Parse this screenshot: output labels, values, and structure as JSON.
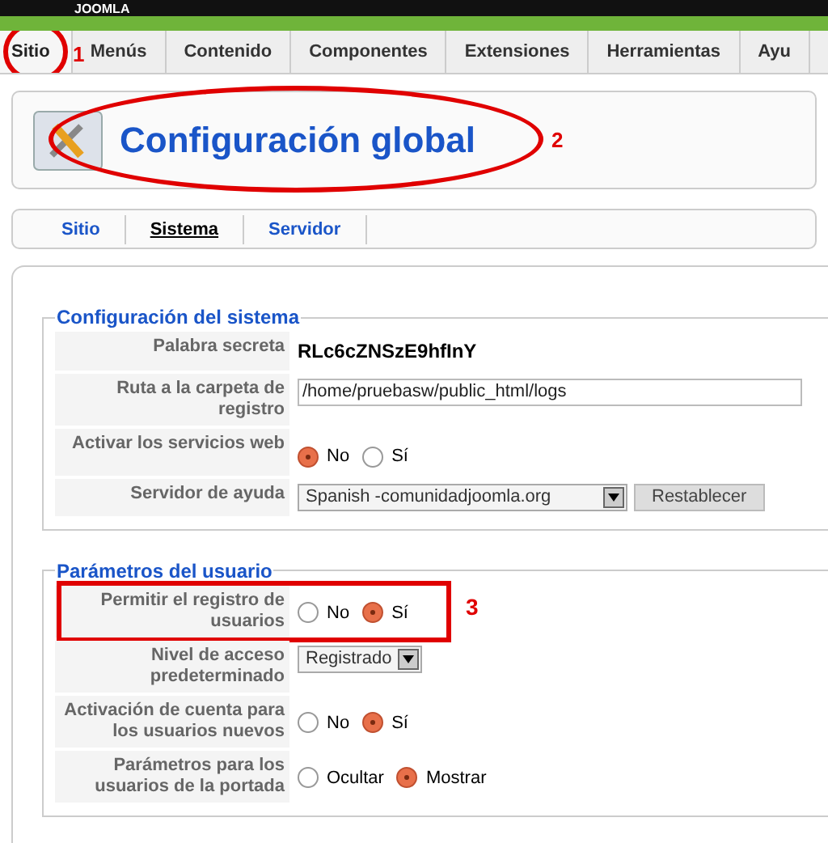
{
  "brand": "JOOMLA",
  "menu": [
    {
      "label": "Sitio",
      "selected": true
    },
    {
      "label": "Menús",
      "selected": false
    },
    {
      "label": "Contenido",
      "selected": false
    },
    {
      "label": "Componentes",
      "selected": false
    },
    {
      "label": "Extensiones",
      "selected": false
    },
    {
      "label": "Herramientas",
      "selected": false
    },
    {
      "label": "Ayu",
      "selected": false
    }
  ],
  "page_title": "Configuración global",
  "subtabs": [
    {
      "label": "Sitio",
      "selected": false
    },
    {
      "label": "Sistema",
      "selected": true
    },
    {
      "label": "Servidor",
      "selected": false
    }
  ],
  "fieldsets": [
    {
      "legend": "Configuración del sistema",
      "rows": [
        {
          "kind": "text",
          "label": "Palabra secreta",
          "value": "RLc6cZNSzE9hfInY"
        },
        {
          "kind": "input",
          "label": "Ruta a la carpeta de registro",
          "value": "/home/pruebasw/public_html/logs"
        },
        {
          "kind": "radio",
          "label": "Activar los servicios web",
          "options": [
            {
              "label": "No",
              "selected": true
            },
            {
              "label": "Sí",
              "selected": false
            }
          ]
        },
        {
          "kind": "select",
          "label": "Servidor de ayuda",
          "value": "Spanish -comunidadjoomla.org",
          "button": "Restablecer"
        }
      ]
    },
    {
      "legend": "Parámetros del usuario",
      "rows": [
        {
          "kind": "radio",
          "label": "Permitir el registro de usuarios",
          "highlighted": true,
          "options": [
            {
              "label": "No",
              "selected": false
            },
            {
              "label": "Sí",
              "selected": true
            }
          ]
        },
        {
          "kind": "select",
          "label": "Nivel de acceso predeterminado",
          "value": "Registrado"
        },
        {
          "kind": "radio",
          "label": "Activación de cuenta para los usuarios nuevos",
          "options": [
            {
              "label": "No",
              "selected": false
            },
            {
              "label": "Sí",
              "selected": true
            }
          ]
        },
        {
          "kind": "radio",
          "label": "Parámetros para los usuarios de la portada",
          "options": [
            {
              "label": "Ocultar",
              "selected": false
            },
            {
              "label": "Mostrar",
              "selected": true
            }
          ]
        }
      ]
    }
  ],
  "annotations": [
    "1",
    "2",
    "3"
  ]
}
